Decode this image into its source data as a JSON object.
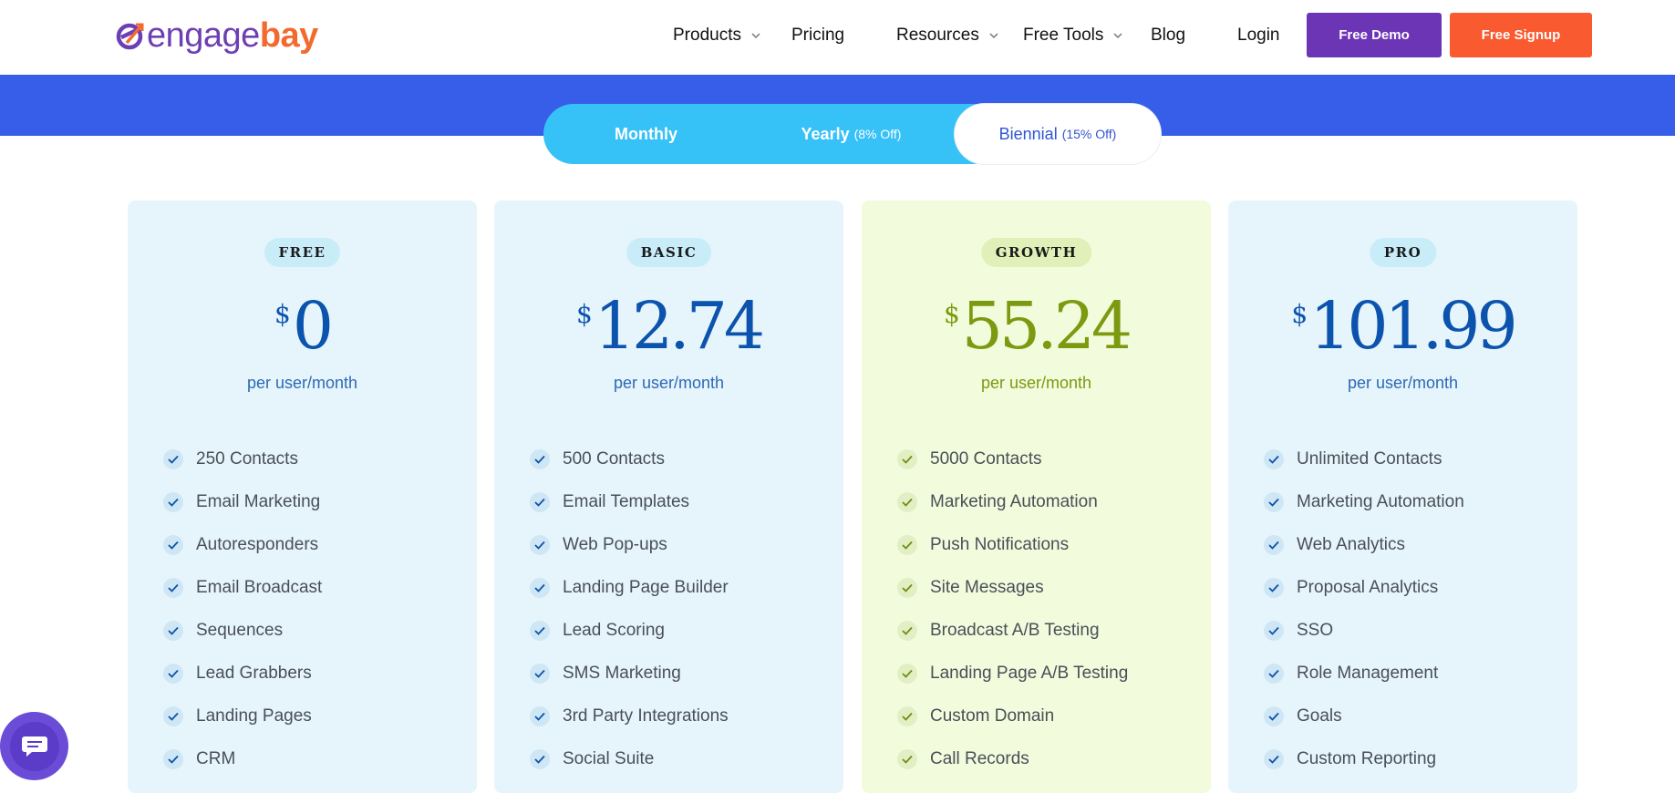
{
  "brand": {
    "name_part1": "engage",
    "name_part2": "bay"
  },
  "nav": {
    "products": "Products",
    "pricing": "Pricing",
    "resources": "Resources",
    "free_tools": "Free Tools",
    "blog": "Blog",
    "login": "Login",
    "free_demo": "Free Demo",
    "free_signup": "Free Signup"
  },
  "billing_toggle": {
    "monthly": "Monthly",
    "yearly": "Yearly",
    "yearly_off": "(8% Off)",
    "biennial": "Biennial",
    "biennial_off": "(15% Off)",
    "selected": "Biennial"
  },
  "plans": [
    {
      "name": "FREE",
      "currency": "$",
      "price": "0",
      "period": "per user/month",
      "features": [
        "250 Contacts",
        "Email Marketing",
        "Autoresponders",
        "Email Broadcast",
        "Sequences",
        "Lead Grabbers",
        "Landing Pages",
        "CRM"
      ]
    },
    {
      "name": "BASIC",
      "currency": "$",
      "price": "12.74",
      "period": "per user/month",
      "features": [
        "500 Contacts",
        "Email Templates",
        "Web Pop-ups",
        "Landing Page Builder",
        "Lead Scoring",
        "SMS Marketing",
        "3rd Party Integrations",
        "Social Suite"
      ]
    },
    {
      "name": "GROWTH",
      "currency": "$",
      "price": "55.24",
      "period": "per user/month",
      "features": [
        "5000 Contacts",
        "Marketing Automation",
        "Push Notifications",
        "Site Messages",
        "Broadcast A/B Testing",
        "Landing Page A/B Testing",
        "Custom Domain",
        "Call Records"
      ]
    },
    {
      "name": "PRO",
      "currency": "$",
      "price": "101.99",
      "period": "per user/month",
      "features": [
        "Unlimited Contacts",
        "Marketing Automation",
        "Web Analytics",
        "Proposal Analytics",
        "SSO",
        "Role Management",
        "Goals",
        "Custom Reporting"
      ]
    }
  ],
  "colors": {
    "brand_purple": "#6c35b5",
    "brand_orange": "#fa5a2f",
    "band_blue": "#365ee8",
    "toggle_cyan": "#36c1f7",
    "price_blue": "#0b53ad",
    "price_green": "#7b9a0f"
  },
  "icons": {
    "dropdown": "chevron-down-icon",
    "feature": "check-icon",
    "chat": "chat-bubble-icon"
  }
}
